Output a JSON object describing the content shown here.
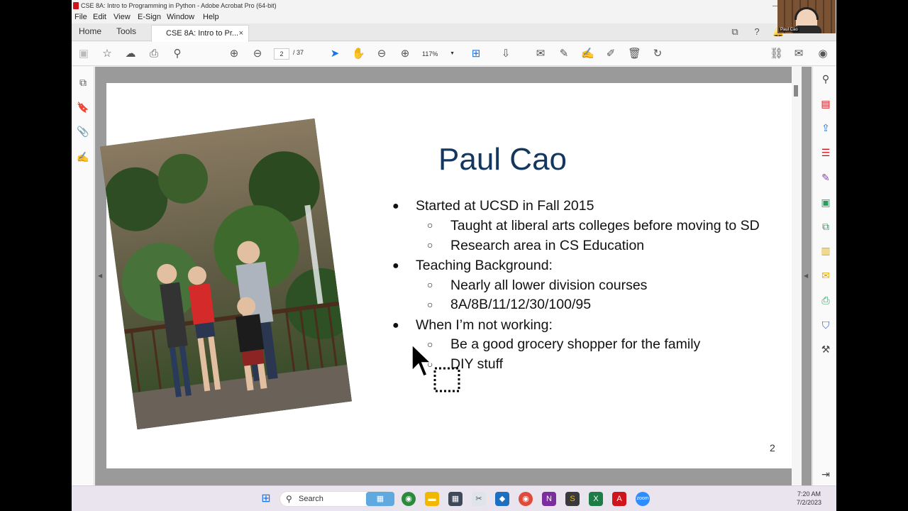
{
  "window": {
    "title": "CSE 8A: Intro to Programming in Python - Adobe Acrobat Pro (64-bit)",
    "minimize_glyph": "—"
  },
  "menu": [
    "File",
    "Edit",
    "View",
    "E-Sign",
    "Window",
    "Help"
  ],
  "tabs": {
    "home": "Home",
    "tools": "Tools",
    "document": "CSE 8A: Intro to Pr...",
    "close": "×"
  },
  "toolbar": {
    "current_page": "2",
    "total_pages": "/ 37",
    "zoom": "117%"
  },
  "slide": {
    "title": "Paul Cao",
    "page_number": "2",
    "bullets": [
      {
        "text": "Started at UCSD in Fall 2015",
        "sub": [
          "Taught at liberal arts colleges before moving to SD",
          "Research area in CS Education"
        ]
      },
      {
        "text": "Teaching Background:",
        "sub": [
          "Nearly all lower division courses",
          "8A/8B/11/12/30/100/95"
        ]
      },
      {
        "text": "When I’m not working:",
        "sub": [
          "Be a good grocery shopper for the family",
          "DIY stuff"
        ]
      }
    ],
    "bullet_marker": "●",
    "sub_marker": "○"
  },
  "taskbar": {
    "search_placeholder": "Search",
    "time": "7:20 AM",
    "date": "7/2/2023"
  },
  "webcam": {
    "name": "Paul Cao"
  },
  "colors": {
    "title_blue": "#13375e",
    "acrobat_red": "#d0141b",
    "link_blue": "#1a73e8"
  }
}
